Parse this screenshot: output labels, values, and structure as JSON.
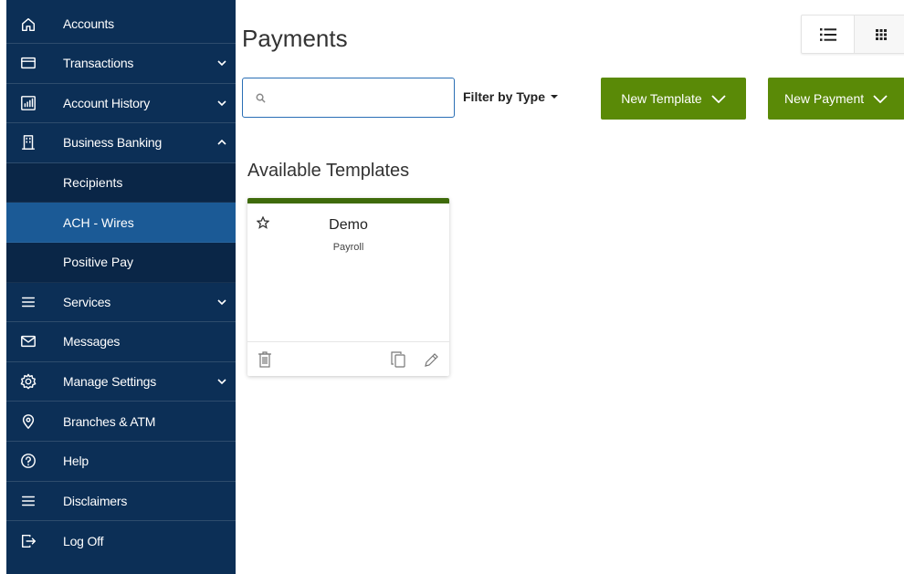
{
  "sidebar": {
    "items": [
      {
        "label": "Accounts",
        "icon": "home-icon"
      },
      {
        "label": "Transactions",
        "icon": "card-icon"
      },
      {
        "label": "Account History",
        "icon": "chart-icon"
      },
      {
        "label": "Business Banking",
        "icon": "building-icon"
      },
      {
        "label": "Services",
        "icon": "menu-icon"
      },
      {
        "label": "Messages",
        "icon": "envelope-icon"
      },
      {
        "label": "Manage Settings",
        "icon": "gear-icon"
      },
      {
        "label": "Branches & ATM",
        "icon": "location-pin-icon"
      },
      {
        "label": "Help",
        "icon": "question-icon"
      },
      {
        "label": "Disclaimers",
        "icon": "menu-icon"
      },
      {
        "label": "Log Off",
        "icon": "logout-icon"
      }
    ],
    "business_banking_sub": [
      {
        "label": "Recipients"
      },
      {
        "label": "ACH - Wires",
        "active": true
      },
      {
        "label": "Positive Pay"
      }
    ]
  },
  "main": {
    "title": "Payments",
    "search_placeholder": "",
    "filter_label": "Filter by Type",
    "new_template_label": "New Template",
    "new_payment_label": "New Payment",
    "section_title": "Available Templates",
    "templates": [
      {
        "name": "Demo",
        "type": "Payroll"
      }
    ]
  },
  "colors": {
    "sidebar_bg": "#0c2f56",
    "active_sub": "#1b5a96",
    "button_green": "#5a8a07",
    "card_accent": "#3f6b0b"
  }
}
